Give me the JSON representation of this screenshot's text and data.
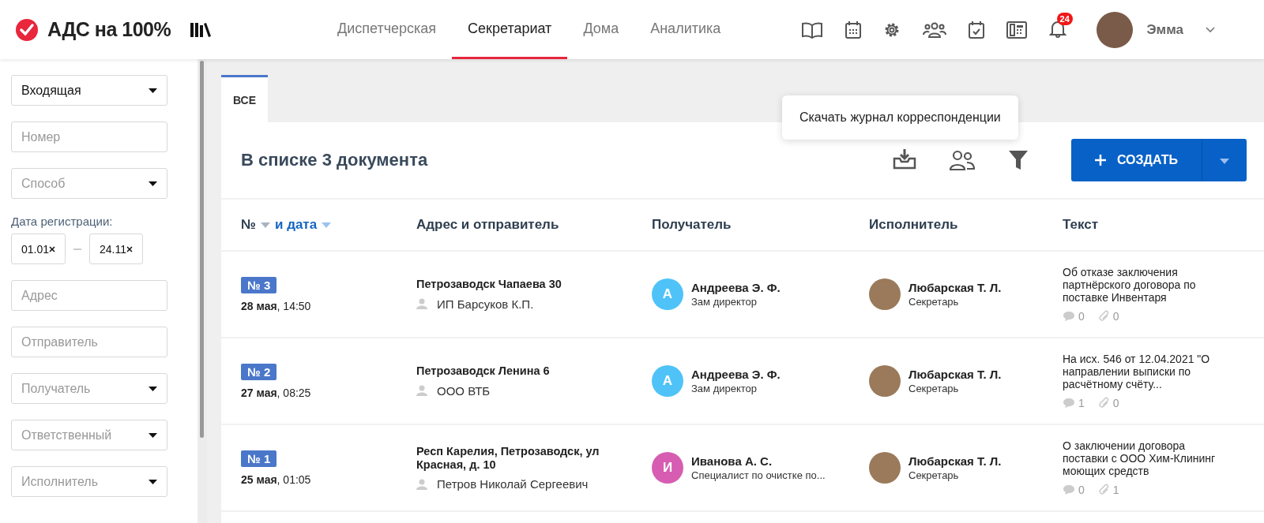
{
  "header": {
    "logo": "АДС на 100%",
    "nav": [
      {
        "label": "Диспетчерская",
        "selected": false
      },
      {
        "label": "Секретариат",
        "selected": true
      },
      {
        "label": "Дома",
        "selected": false
      },
      {
        "label": "Аналитика",
        "selected": false
      }
    ],
    "notifications": "24",
    "user": "Эмма"
  },
  "filters": [
    {
      "kind": "select",
      "value": "Входящая"
    },
    {
      "kind": "text",
      "placeholder": "Номер"
    },
    {
      "kind": "select",
      "placeholder": "Способ"
    },
    {
      "kind": "label",
      "text": "Дата регистрации:"
    },
    {
      "kind": "daterange",
      "from": "01.01",
      "to": "24.11"
    },
    {
      "kind": "text",
      "placeholder": "Адрес"
    },
    {
      "kind": "text",
      "placeholder": "Отправитель"
    },
    {
      "kind": "select",
      "placeholder": "Получатель"
    },
    {
      "kind": "select",
      "placeholder": "Ответственный"
    },
    {
      "kind": "select",
      "placeholder": "Исполнитель"
    }
  ],
  "tabs": [
    {
      "label": "ВСЕ",
      "selected": true
    }
  ],
  "list": {
    "title": "В списке 3 документа",
    "tooltip": "Скачать журнал корреспонденции",
    "create_button": "СОЗДАТЬ"
  },
  "table": {
    "columns": [
      {
        "kind": "sort",
        "label": "№",
        "link": "и дата"
      },
      {
        "kind": "plain",
        "label": "Адрес и отправитель"
      },
      {
        "kind": "plain",
        "label": "Получатель"
      },
      {
        "kind": "plain",
        "label": "Исполнитель"
      },
      {
        "kind": "plain",
        "label": "Текст"
      }
    ],
    "rows": [
      {
        "number": "№ 3",
        "date": "**28 мая**, 14:50",
        "address": "Петрозаводск Чапаева 30",
        "sender": "ИП Барсуков К.П.",
        "recipient": {
          "initial": "А",
          "color": "#4fc3f7",
          "name": "Андреева Э. Ф.",
          "role": "Зам директор"
        },
        "executor": {
          "name": "Любарская Т. Л.",
          "role": "Секретарь"
        },
        "text": "Об отказе заключения партнёрского договора по поставке Инвентаря",
        "comments": "0",
        "attachments": "0"
      },
      {
        "number": "№ 2",
        "date": "**27 мая**, 08:25",
        "address": "Петрозаводск Ленина 6",
        "sender": "ООО ВТБ",
        "recipient": {
          "initial": "А",
          "color": "#4fc3f7",
          "name": "Андреева Э. Ф.",
          "role": "Зам директор"
        },
        "executor": {
          "name": "Любарская Т. Л.",
          "role": "Секретарь"
        },
        "text": "На исх. 546 от 12.04.2021 \"О направлении выписки по расчётному счёту...",
        "comments": "1",
        "attachments": "0"
      },
      {
        "number": "№ 1",
        "date": "**25 мая**, 01:05",
        "address": "Респ Карелия, Петрозаводск, ул Красная, д. 10",
        "sender": "Петров Николай Сергеевич",
        "recipient": {
          "initial": "И",
          "color": "#d65db1",
          "name": "Иванова А. С.",
          "role": "Специалист по очистке по..."
        },
        "executor": {
          "name": "Любарская Т. Л.",
          "role": "Секретарь"
        },
        "text": "О заключении договора поставки с ООО Хим-Клининг моющих средств",
        "comments": "0",
        "attachments": "1"
      }
    ]
  }
}
